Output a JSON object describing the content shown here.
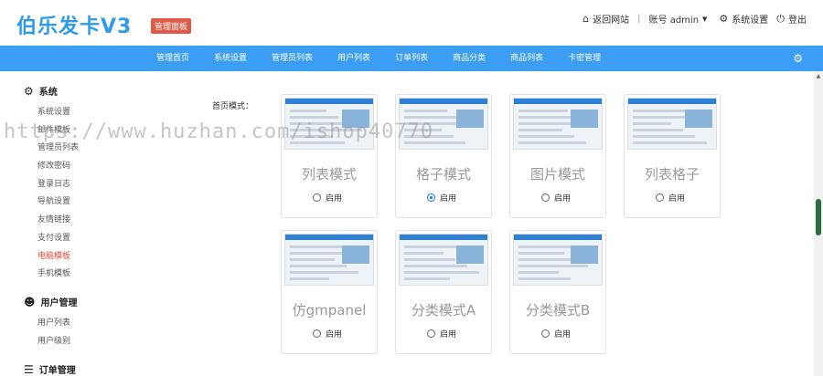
{
  "header": {
    "logo": "伯乐发卡V3",
    "badge": "管理面板",
    "home_link": "返回网站",
    "account": "账号 admin",
    "settings": "系统设置",
    "logout": "登出"
  },
  "nav": {
    "items": [
      "管理首页",
      "系统设置",
      "管理员列表",
      "用户列表",
      "订单列表",
      "商品分类",
      "商品列表",
      "卡密管理"
    ]
  },
  "sidebar": {
    "sections": [
      {
        "title": "系统",
        "icon": "gear-icon",
        "items": [
          "系统设置",
          "邮件模板",
          "管理员列表",
          "修改密码",
          "登录日志",
          "导航设置",
          "友情链接",
          "支付设置",
          "电脑模板",
          "手机模板"
        ]
      },
      {
        "title": "用户管理",
        "icon": "user-icon",
        "items": [
          "用户列表",
          "用户级别"
        ]
      },
      {
        "title": "订单管理",
        "icon": "list-icon",
        "items": []
      }
    ],
    "active_item": "电脑模板"
  },
  "main": {
    "label": "首页模式：",
    "radio_label": "启用",
    "templates": [
      {
        "name": "列表模式",
        "selected": false
      },
      {
        "name": "格子模式",
        "selected": true
      },
      {
        "name": "图片模式",
        "selected": false
      },
      {
        "name": "列表格子",
        "selected": false
      },
      {
        "name": "仿gmpanel",
        "selected": false
      },
      {
        "name": "分类模式A",
        "selected": false
      },
      {
        "name": "分类模式B",
        "selected": false
      }
    ]
  },
  "watermark": "https://www.huzhan.com/ishop40770",
  "colors": {
    "brand": "#2f9be8",
    "nav": "#3b9df3",
    "active": "#e74c3c",
    "badge": "#e05a4a"
  }
}
